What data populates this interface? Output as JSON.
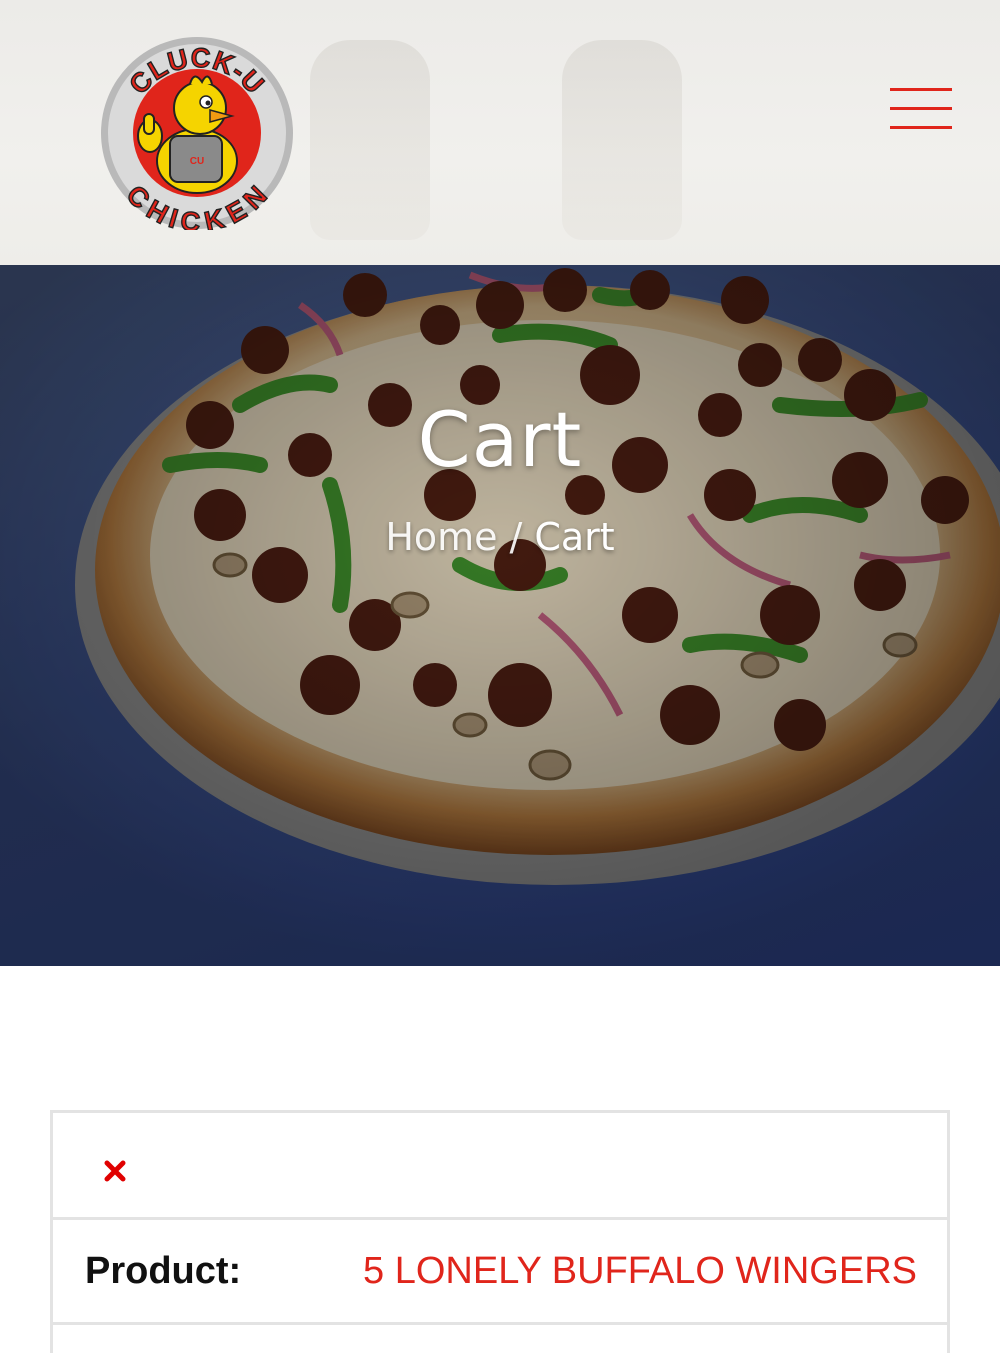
{
  "header": {
    "logo": {
      "top_text": "CLUCK-U",
      "bottom_text": "CHICKEN",
      "icon": "chicken-mascot-logo"
    },
    "menu_icon": "hamburger-menu-icon"
  },
  "hero": {
    "title": "Cart",
    "breadcrumb": {
      "home": "Home",
      "separator": "/",
      "current": "Cart"
    }
  },
  "cart": {
    "remove_icon": "close-x-icon",
    "product_label": "Product:",
    "product_name": "5 LONELY BUFFALO WINGERS"
  },
  "colors": {
    "accent": "#e0251b",
    "border": "#e3e3e3"
  }
}
